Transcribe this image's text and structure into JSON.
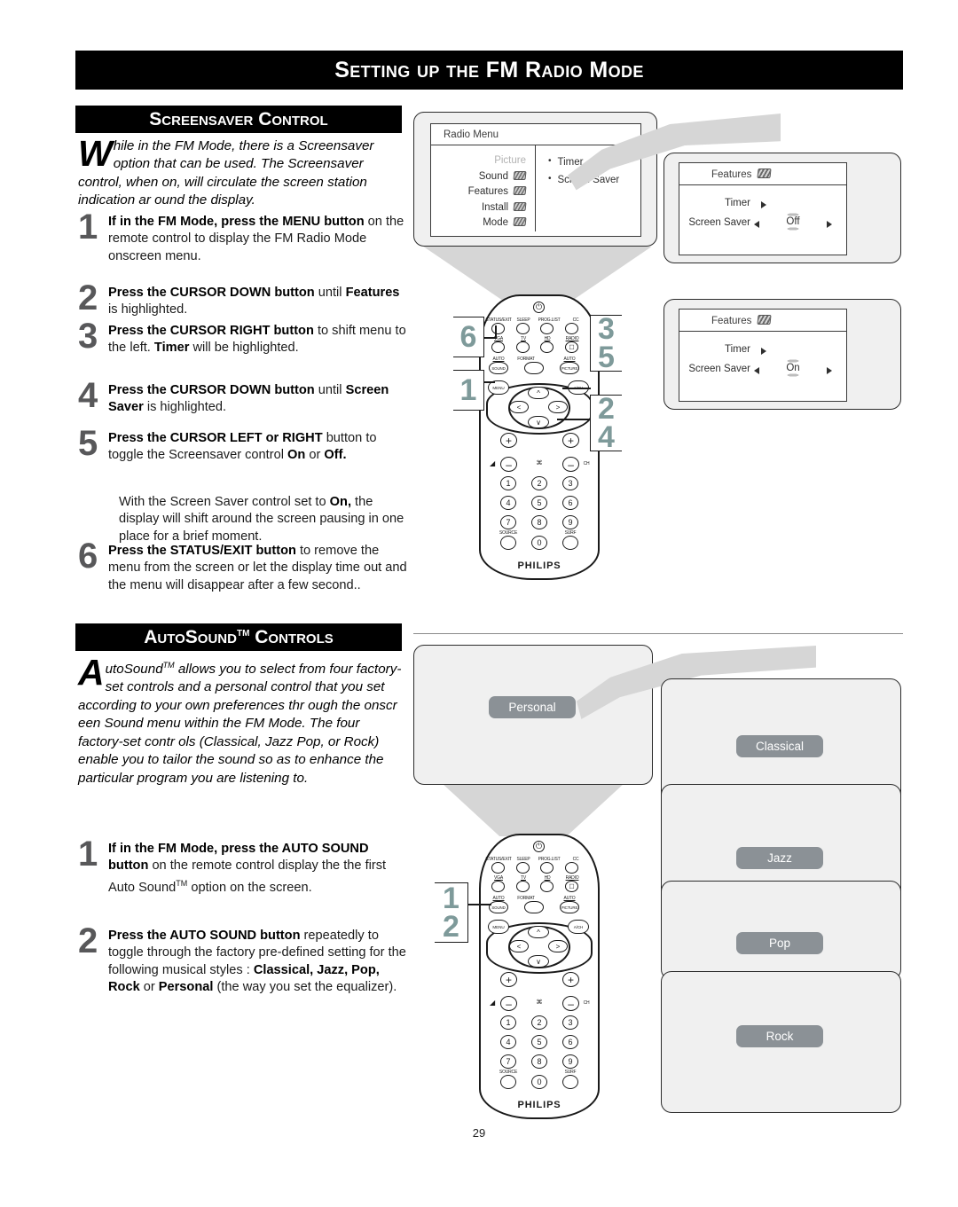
{
  "page": {
    "title_prefix": "Setting up the ",
    "title_fm": "FM",
    "title_suffix": " Radio Mode",
    "number": "29"
  },
  "sections": {
    "screensaver": {
      "heading": "Screensaver Control",
      "intro_dropcap": "W",
      "intro_text": "hile in the FM Mode, there is a Screensaver option that can be used. The Screensaver control, when on, will circulate the screen station indication ar ound the display.",
      "steps": [
        {
          "num": "1",
          "html": "<b>If in the FM Mode, press the MENU button</b> on the remote control to display the FM Radio Mode onscreen menu."
        },
        {
          "num": "2",
          "html": "<b>Press the CURSOR DOWN button</b> until <b>Features</b> is highlighted."
        },
        {
          "num": "3",
          "html": "<b>Press the CURSOR RIGHT button</b> to shift menu to the left. <b>Timer</b> will be highlighted."
        },
        {
          "num": "4",
          "html": "<b>Press the CURSOR DOWN button</b> until <b>Screen Saver</b> is highlighted."
        },
        {
          "num": "5",
          "html": "<b>Press the CURSOR LEFT or RIGHT</b> button to toggle the Screensaver control <b>On</b> or <b>Off.</b>"
        },
        {
          "num": "6",
          "html": "<b>Press the STATUS/EXIT button</b> to remove the menu from the screen or let the display time out and the menu will disappear after a few second.."
        }
      ],
      "note_html": "With the Screen Saver control set to <b>On,</b> the display will shift around the screen pausing in one place for a brief moment."
    },
    "autosound": {
      "heading_a": "AutoSound",
      "heading_tm": "TM",
      "heading_b": " Controls",
      "intro_dropcap": "A",
      "intro_text": "utoSound<sup>TM</sup> allows you to select from four factory-set controls and a personal control that you set according to your own preferences thr ough the onscr een Sound menu within the FM Mode. The four factory-set contr ols (Classical, Jazz Pop, or Rock) enable you to tailor the sound so as to enhance the particular program you are listening to.",
      "steps": [
        {
          "num": "1",
          "html": "<b>If in the FM Mode, press the AUTO SOUND button</b> on the remote control display the the first Auto Sound<sup>TM</sup> option on the screen."
        },
        {
          "num": "2",
          "html": "<b>Press the AUTO SOUND button</b> repeatedly to toggle through the factory pre-defined setting for the following musical styles : <b>Classical, Jazz, Pop, Rock</b> or <b>Personal</b> (the way you set the equalizer)."
        }
      ]
    }
  },
  "osd": {
    "radio_menu": {
      "title": "Radio Menu",
      "left_items": [
        "Picture",
        "Sound",
        "Features",
        "Install",
        "Mode"
      ],
      "right_items": [
        "Timer",
        "Screen Saver"
      ]
    },
    "features_off": {
      "title": "Features",
      "row_timer": "Timer",
      "row_screensaver": "Screen Saver",
      "value": "Off"
    },
    "features_on": {
      "title": "Features",
      "row_timer": "Timer",
      "row_screensaver": "Screen Saver",
      "value": "On"
    }
  },
  "callouts": {
    "ss_left_top": "6",
    "ss_left_bottom": "1",
    "ss_right_top_a": "3",
    "ss_right_top_b": "5",
    "ss_right_bottom_a": "2",
    "ss_right_bottom_b": "4",
    "as_left_a": "1",
    "as_left_b": "2"
  },
  "remote": {
    "brand": "PHILIPS",
    "row1": [
      "STATUS/EXIT",
      "SLEEP",
      "PROG.LIST",
      "CC"
    ],
    "row2": [
      "VGA",
      "TV",
      "HD",
      "RADIO"
    ],
    "row3_left_top": "AUTO",
    "row3_left": "SOUND",
    "row3_mid": "FORMAT",
    "row3_right_top": "AUTO",
    "row3_right": "PICTURE",
    "menu": "MENU",
    "ach": "A/CH",
    "vol": "◢",
    "ch": "CH",
    "keys": [
      "1",
      "2",
      "3",
      "4",
      "5",
      "6",
      "7",
      "8",
      "9",
      "0"
    ],
    "source": "SOURCE",
    "surf": "SURF",
    "plus": "+",
    "minus": "–",
    "mute": "⌘",
    "power": "⏻"
  },
  "presets": {
    "personal": "Personal",
    "classical": "Classical",
    "jazz": "Jazz",
    "pop": "Pop",
    "rock": "Rock"
  }
}
